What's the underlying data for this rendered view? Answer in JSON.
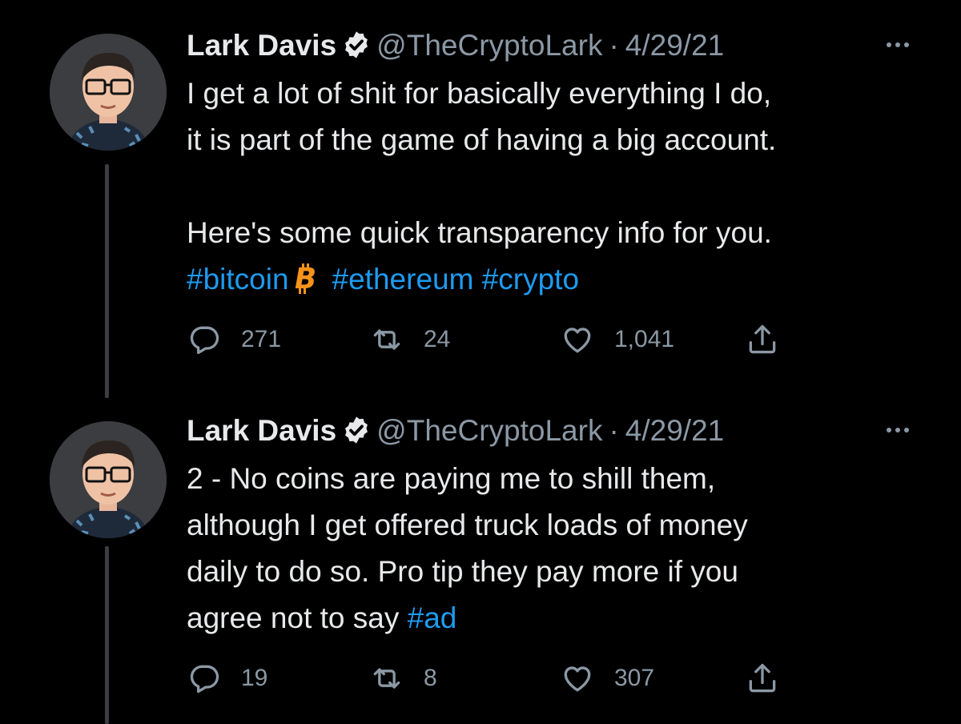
{
  "tweets": [
    {
      "name": "Lark Davis",
      "handle": "@TheCryptoLark",
      "separator": "·",
      "date": "4/29/21",
      "text_lines": [
        "I get a lot of shit for basically everything I do,",
        "it is part of the game of having a big account.",
        "",
        "Here's some quick transparency info for you."
      ],
      "hashtags": [
        "#bitcoin",
        "#ethereum",
        "#crypto"
      ],
      "replies": "271",
      "retweets": "24",
      "likes": "1,041"
    },
    {
      "name": "Lark Davis",
      "handle": "@TheCryptoLark",
      "separator": "·",
      "date": "4/29/21",
      "text_lines": [
        "2 - No coins are paying me to shill them,",
        "although I get offered truck loads of money",
        "daily to do so. Pro tip they pay more if you"
      ],
      "last_line_text": "agree not to say",
      "last_line_hashtag": "#ad",
      "replies": "19",
      "retweets": "8",
      "likes": "307"
    }
  ],
  "icons": [
    "verified-icon",
    "more-icon",
    "reply-icon",
    "retweet-icon",
    "like-icon",
    "share-icon",
    "bitcoin-icon"
  ],
  "colors": {
    "background": "#000000",
    "text": "#e7e9ea",
    "muted": "#8b98a5",
    "link": "#1d9bf0",
    "bitcoin": "#f7931a"
  }
}
